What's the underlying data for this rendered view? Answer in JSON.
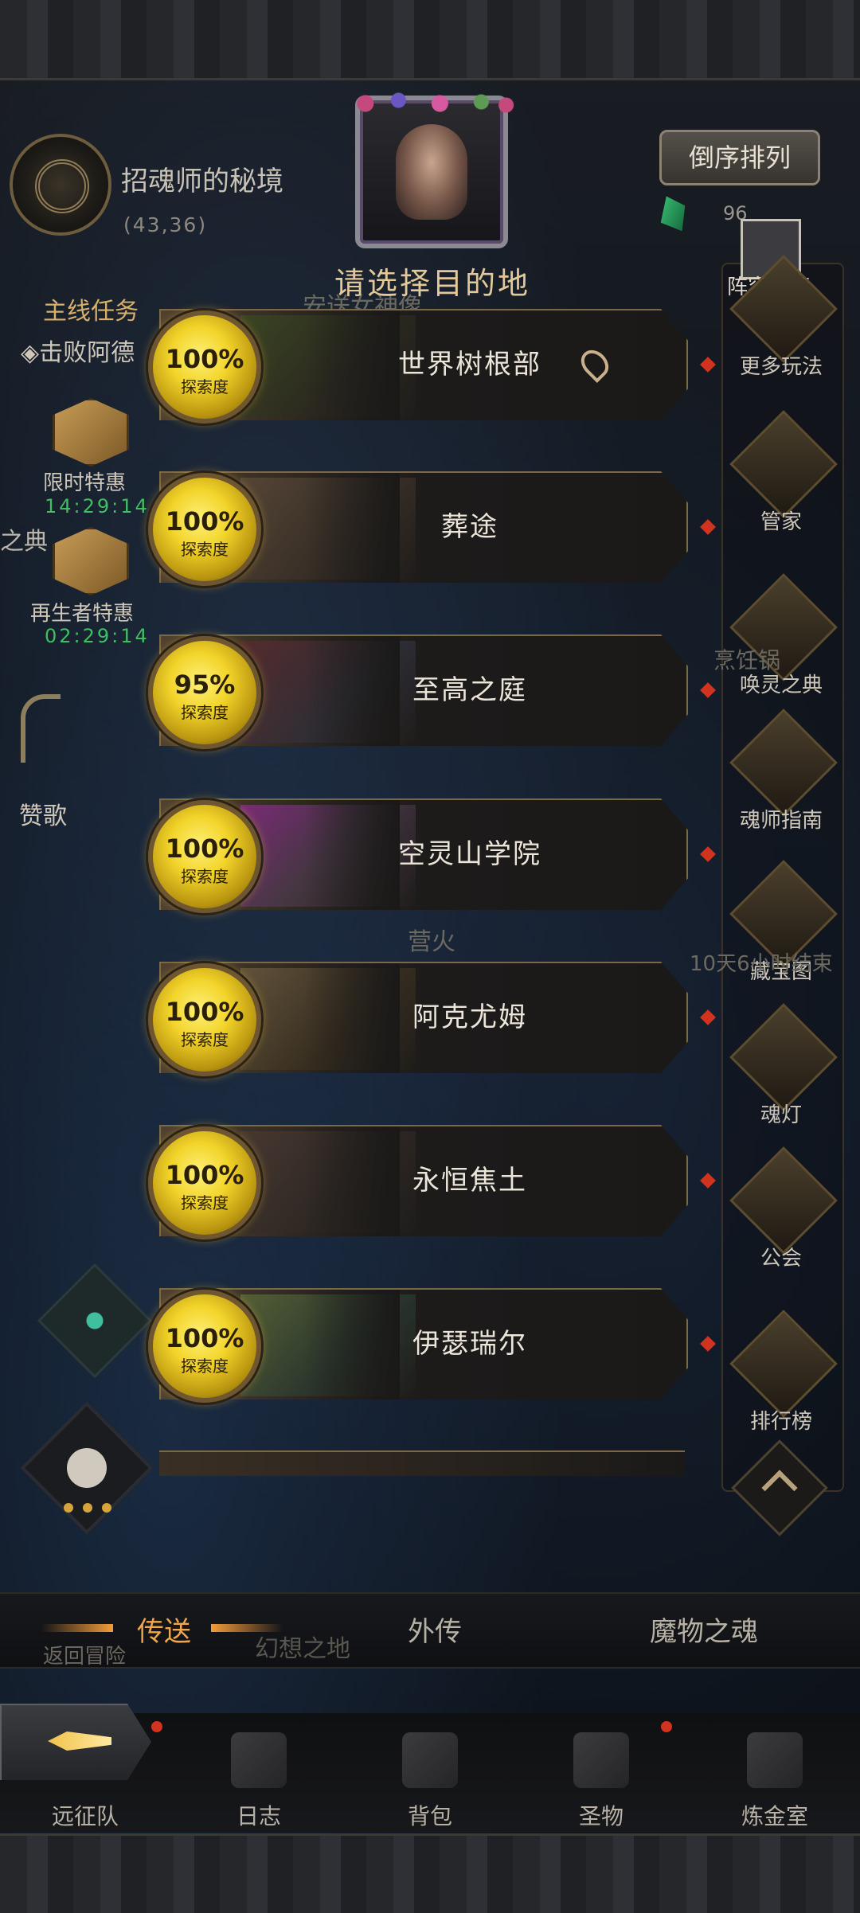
{
  "header": {
    "map_name": "招魂师的秘境",
    "map_coords": "(43,36)",
    "sort_button": "倒序排列",
    "gem_count": "96",
    "dialog_title": "请选择目的地",
    "bg_statue_label": "安送女神像"
  },
  "left_hud": {
    "main_quest_title": "主线任务",
    "main_quest_text": "◈击败阿德",
    "offer_1_label": "限时特惠",
    "offer_1_timer": "14:29:14",
    "offer_2_label": "再生者特惠",
    "offer_2_timer": "02:29:14",
    "codex_partial": "之典",
    "anthem": "赞歌"
  },
  "destinations": [
    {
      "name": "世界树根部",
      "progress": "100%",
      "progress_label": "探索度",
      "current": true
    },
    {
      "name": "葬途",
      "progress": "100%",
      "progress_label": "探索度"
    },
    {
      "name": "至高之庭",
      "progress": "95%",
      "progress_label": "探索度"
    },
    {
      "name": "空灵山学院",
      "progress": "100%",
      "progress_label": "探索度"
    },
    {
      "name": "阿克尤姆",
      "progress": "100%",
      "progress_label": "探索度"
    },
    {
      "name": "永恒焦土",
      "progress": "100%",
      "progress_label": "探索度"
    },
    {
      "name": "伊瑟瑞尔",
      "progress": "100%",
      "progress_label": "探索度"
    }
  ],
  "right_menu": {
    "lineup": "阵容推荐",
    "items": [
      "更多玩法",
      "管家",
      "唤灵之典",
      "魂师指南",
      "藏宝图",
      "魂灯",
      "公会",
      "排行榜"
    ],
    "bg_cooking": "烹饪锅",
    "bg_timer": "10天6小时结束",
    "bg_fire": "营火"
  },
  "tabs": {
    "teleport": "传送",
    "side_story": "外传",
    "monster_soul": "魔物之魂",
    "bg_return": "返回冒险",
    "bg_fantasy": "幻想之地"
  },
  "nav": {
    "expedition": "远征队",
    "journal": "日志",
    "backpack": "背包",
    "relic": "圣物",
    "alchemy": "炼金室"
  },
  "colors": {
    "accent_gold": "#e3c99a",
    "active_tab": "#f0a64a",
    "timer_green": "#3fbf62",
    "alert_red": "#d2331f"
  }
}
